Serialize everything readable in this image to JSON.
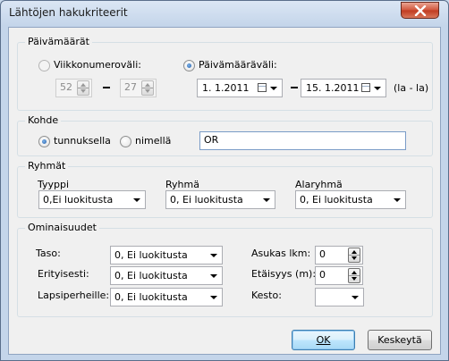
{
  "window": {
    "title": "Lähtöjen hakukriteerit"
  },
  "paivamaarat": {
    "title": "Päivämäärät",
    "viikko_label": "Viikkonumeroväli:",
    "viikko_from": "52",
    "viikko_to": "27",
    "paiva_label": "Päivämääräväli:",
    "date_from": "1.  1.2011",
    "date_to": "15.  1.2011",
    "range_note": "(la - la)"
  },
  "kohde": {
    "title": "Kohde",
    "tunnuksella": "tunnuksella",
    "nimella": "nimellä",
    "value": "OR"
  },
  "ryhmat": {
    "title": "Ryhmät",
    "tyyppi_label": "Tyyppi",
    "tyyppi_value": "0,Ei luokitusta",
    "ryhma_label": "Ryhmä",
    "ryhma_value": "0, Ei luokitusta",
    "alaryhma_label": "Alaryhmä",
    "alaryhma_value": "0, Ei luokitusta"
  },
  "ominaisuudet": {
    "title": "Ominaisuudet",
    "taso_label": "Taso:",
    "taso_value": "0, Ei luokitusta",
    "erityisesti_label": "Erityisesti:",
    "erityisesti_value": "0, Ei luokitusta",
    "lapsiperheille_label": "Lapsiperheille:",
    "lapsiperheille_value": "0, Ei luokitusta",
    "asukas_label": "Asukas lkm:",
    "asukas_value": "0",
    "etaisyys_label": "Etäisyys (m):",
    "etaisyys_value": "0",
    "kesto_label": "Kesto:",
    "kesto_value": ""
  },
  "buttons": {
    "ok": "OK",
    "cancel": "Keskeytä"
  }
}
